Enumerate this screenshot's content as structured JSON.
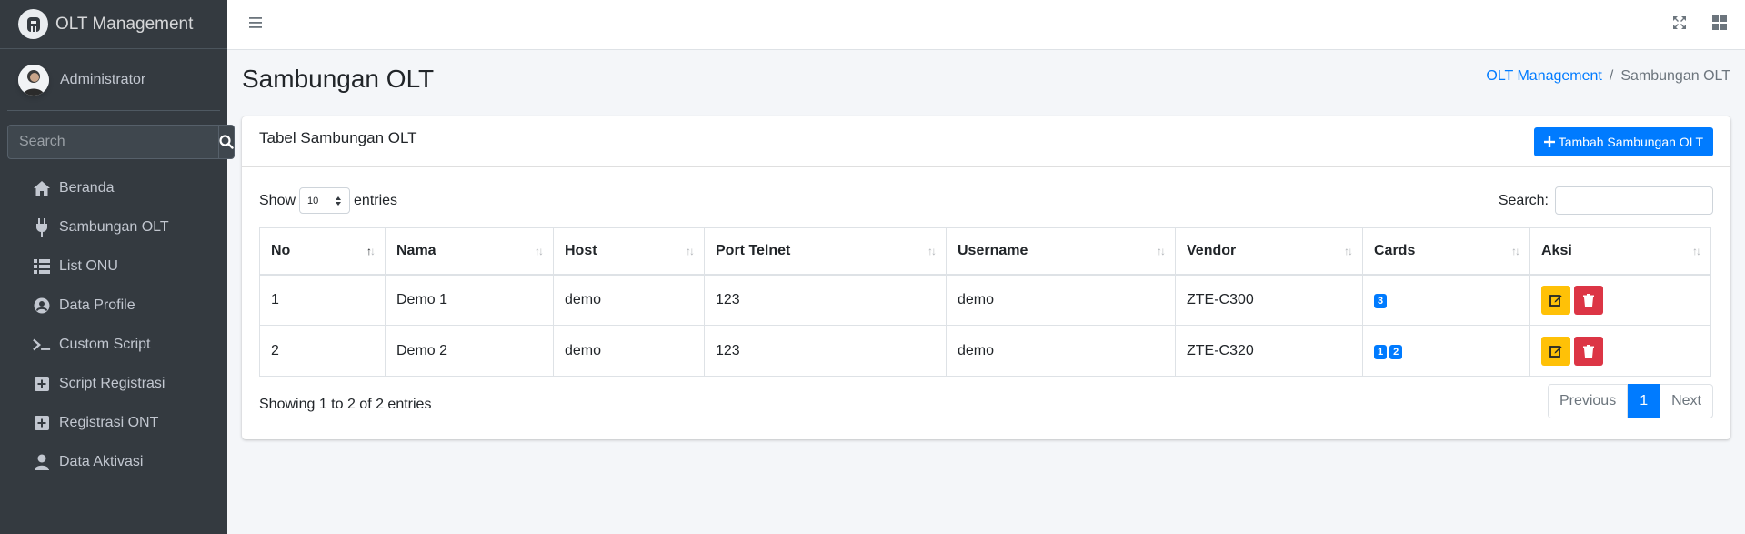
{
  "brand": {
    "title": "OLT Management"
  },
  "user": {
    "name": "Administrator"
  },
  "sidebar_search": {
    "placeholder": "Search"
  },
  "nav": [
    {
      "label": "Beranda",
      "icon": "home-icon"
    },
    {
      "label": "Sambungan OLT",
      "icon": "plug-icon"
    },
    {
      "label": "List ONU",
      "icon": "list-icon"
    },
    {
      "label": "Data Profile",
      "icon": "user-circle-icon"
    },
    {
      "label": "Custom Script",
      "icon": "terminal-icon"
    },
    {
      "label": "Script Registrasi",
      "icon": "plus-square-icon"
    },
    {
      "label": "Registrasi ONT",
      "icon": "plus-square-icon"
    },
    {
      "label": "Data Aktivasi",
      "icon": "user-icon"
    }
  ],
  "page": {
    "title": "Sambungan OLT",
    "breadcrumb": {
      "home": "OLT Management",
      "separator": "/",
      "current": "Sambungan OLT"
    }
  },
  "card": {
    "title": "Tabel Sambungan OLT",
    "add_button": "Tambah Sambungan OLT"
  },
  "table_controls": {
    "show_label": "Show",
    "entries_value": "10",
    "entries_label": "entries",
    "search_label": "Search:"
  },
  "table": {
    "columns": [
      "No",
      "Nama",
      "Host",
      "Port Telnet",
      "Username",
      "Vendor",
      "Cards",
      "Aksi"
    ],
    "rows": [
      {
        "no": "1",
        "nama": "Demo 1",
        "host": "demo",
        "port": "123",
        "username": "demo",
        "vendor": "ZTE-C300",
        "cards": [
          "3"
        ]
      },
      {
        "no": "2",
        "nama": "Demo 2",
        "host": "demo",
        "port": "123",
        "username": "demo",
        "vendor": "ZTE-C320",
        "cards": [
          "1",
          "2"
        ]
      }
    ]
  },
  "footer": {
    "info": "Showing 1 to 2 of 2 entries",
    "previous": "Previous",
    "page": "1",
    "next": "Next"
  },
  "colors": {
    "sidebar": "#343a40",
    "primary": "#007bff",
    "warning": "#ffc107",
    "danger": "#dc3545"
  }
}
